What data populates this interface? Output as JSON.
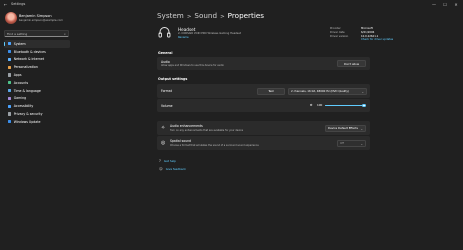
{
  "window": {
    "title": "Settings",
    "controls": {
      "minimize": "—",
      "maximize": "☐",
      "close": "✕"
    }
  },
  "user": {
    "name": "Benjamin Simpson",
    "email": "benjamin.simpson@example.com"
  },
  "search": {
    "placeholder": "Find a setting"
  },
  "nav": {
    "items": [
      {
        "label": "System",
        "color": "#4aa3ff",
        "active": true
      },
      {
        "label": "Bluetooth & devices",
        "color": "#3b8eea",
        "active": false
      },
      {
        "label": "Network & internet",
        "color": "#5fb3ff",
        "active": false
      },
      {
        "label": "Personalization",
        "color": "#e8a14a",
        "active": false
      },
      {
        "label": "Apps",
        "color": "#9aa0a6",
        "active": false
      },
      {
        "label": "Accounts",
        "color": "#4fc38a",
        "active": false
      },
      {
        "label": "Time & language",
        "color": "#5aa7e6",
        "active": false
      },
      {
        "label": "Gaming",
        "color": "#a58ad8",
        "active": false
      },
      {
        "label": "Accessibility",
        "color": "#4aa3ff",
        "active": false
      },
      {
        "label": "Privacy & security",
        "color": "#9aa0a6",
        "active": false
      },
      {
        "label": "Windows Update",
        "color": "#3b8eea",
        "active": false
      }
    ]
  },
  "breadcrumb": {
    "items": [
      "System",
      "Sound",
      "Properties"
    ],
    "separator": ">"
  },
  "device": {
    "name": "Headset",
    "subtitle": "2- CORSAIR VOID PRO Wireless Gaming Headset",
    "rename_label": "Rename",
    "icon": "headset-icon",
    "meta": [
      {
        "key": "Provider",
        "value": "Microsoft"
      },
      {
        "key": "Driver date",
        "value": "6/21/2006"
      },
      {
        "key": "Driver version",
        "value": "10.0.22621.1"
      },
      {
        "key": "",
        "value": "Check for driver updates",
        "link": true
      }
    ]
  },
  "general": {
    "section_label": "General",
    "audio": {
      "title": "Audio",
      "description": "Allow apps and Windows to use this device for audio",
      "button": "Don't allow"
    }
  },
  "output": {
    "section_label": "Output settings",
    "format": {
      "title": "Format",
      "test_button": "Test",
      "value": "2 channels, 16 bit, 48000 Hz (DVD Quality)"
    },
    "volume": {
      "title": "Volume",
      "value": "100",
      "level": 1.0,
      "icon": "speaker-icon"
    }
  },
  "enhancements": {
    "audio_enhancements": {
      "title": "Audio enhancements",
      "description": "Turn on any enhancements that are available for your device",
      "value": "Device Default Effects",
      "icon": "enhance-icon"
    },
    "spatial_sound": {
      "title": "Spatial sound",
      "description": "Choose a format that emulates the sound of a surround sound experience",
      "value": "Off",
      "enabled": false,
      "icon": "spatial-icon"
    }
  },
  "links": [
    {
      "label": "Get help",
      "icon": "help-icon"
    },
    {
      "label": "Give feedback",
      "icon": "feedback-icon"
    }
  ],
  "colors": {
    "accent": "#60cdff",
    "background": "#202020",
    "card": "#2b2b2b"
  }
}
